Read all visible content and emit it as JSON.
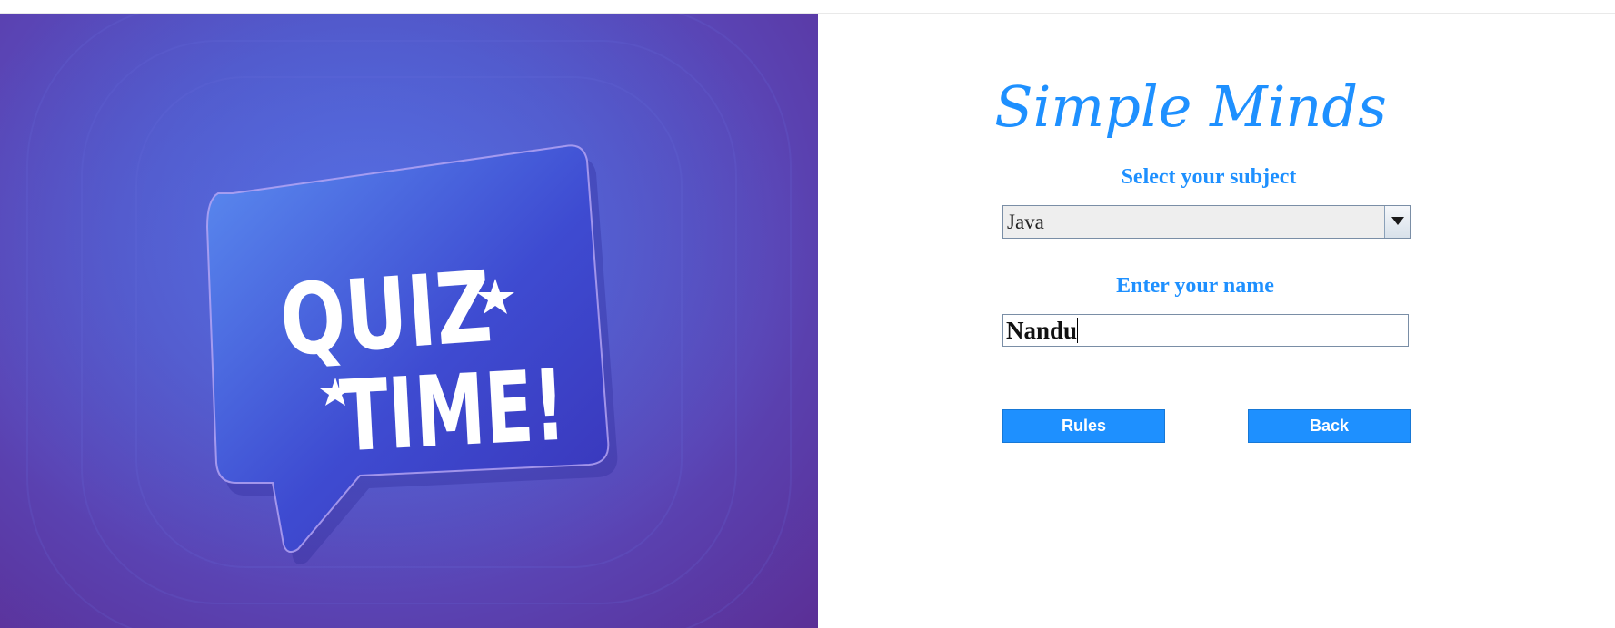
{
  "hero": {
    "line1": "QUIZ",
    "line2": "TIME!"
  },
  "app": {
    "title": "Simple Minds"
  },
  "form": {
    "subject_label": "Select your subject",
    "subject_selected": "Java",
    "name_label": "Enter your name",
    "name_value": "Nandu"
  },
  "buttons": {
    "rules": "Rules",
    "back": "Back"
  },
  "colors": {
    "accent": "#1e90ff",
    "hero_purple": "#5a44b4",
    "bubble_blue": "#4a5fd6"
  }
}
